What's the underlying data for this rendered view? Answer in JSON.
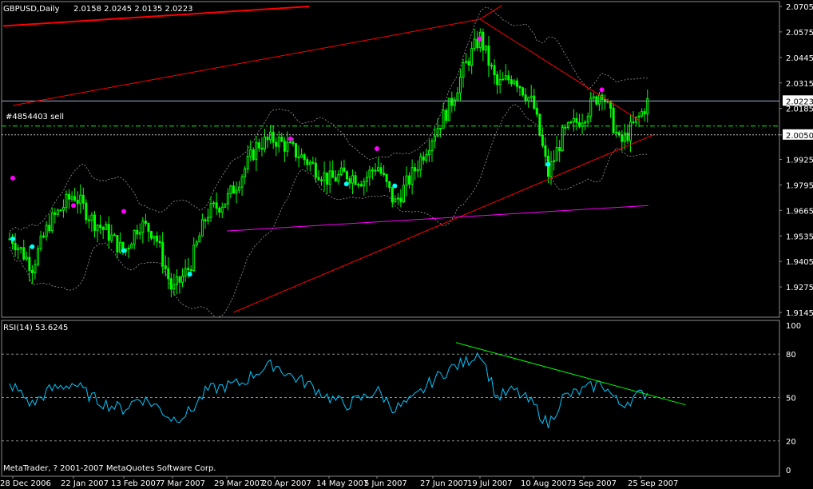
{
  "header": {
    "symbol": "GBPUSD,Daily",
    "ohlc": "2.0158 2.0245 2.0135 2.0223"
  },
  "order_label": "#4854403 sell",
  "rsi_title": "RSI(14) 53.6245",
  "copyright": "MetaTrader, ? 2001-2007 MetaQuotes Software Corp.",
  "colors": {
    "background": "#000000",
    "candle": "#00ff00",
    "channel": "#ff0000",
    "support": "#ff00ff",
    "rsi_line": "#00c8ff",
    "rsi_trend": "#00ff00",
    "bands": "#9a9a9a",
    "dot_magenta": "#ff00ff",
    "dot_cyan": "#00ffff",
    "price_marker": "#9fb2cf"
  },
  "chart_data": [
    {
      "type": "candlestick",
      "symbol": "GBPUSD",
      "timeframe": "Daily",
      "ylim": [
        1.9145,
        2.0705
      ],
      "y_ticks": [
        "2.0705",
        "2.0575",
        "2.0445",
        "2.0315",
        "2.0185",
        "2.0050",
        "1.9925",
        "1.9795",
        "1.9665",
        "1.9535",
        "1.9405",
        "1.9275",
        "1.9145"
      ],
      "x_ticks": [
        "28 Dec 2006",
        "22 Jan 2007",
        "13 Feb 2007",
        "7 Mar 2007",
        "29 Mar 2007",
        "20 Apr 2007",
        "14 May 2007",
        "5 Jun 2007",
        "27 Jun 2007",
        "19 Jul 2007",
        "10 Aug 2007",
        "3 Sep 2007",
        "25 Sep 2007"
      ],
      "current_price": "2.0223",
      "order_price": "2.0050",
      "close_path": [
        [
          "28 Dec 2006",
          1.952
        ],
        [
          "5 Jan 2007",
          1.938
        ],
        [
          "12 Jan 2007",
          1.96
        ],
        [
          "22 Jan 2007",
          1.975
        ],
        [
          "30 Jan 2007",
          1.962
        ],
        [
          "6 Feb 2007",
          1.955
        ],
        [
          "13 Feb 2007",
          1.945
        ],
        [
          "20 Feb 2007",
          1.96
        ],
        [
          "27 Feb 2007",
          1.955
        ],
        [
          "7 Mar 2007",
          1.925
        ],
        [
          "14 Mar 2007",
          1.938
        ],
        [
          "21 Mar 2007",
          1.965
        ],
        [
          "29 Mar 2007",
          1.972
        ],
        [
          "5 Apr 2007",
          1.985
        ],
        [
          "12 Apr 2007",
          2.0
        ],
        [
          "20 Apr 2007",
          2.003
        ],
        [
          "27 Apr 2007",
          1.998
        ],
        [
          "4 May 2007",
          1.992
        ],
        [
          "14 May 2007",
          1.982
        ],
        [
          "22 May 2007",
          1.985
        ],
        [
          "30 May 2007",
          1.982
        ],
        [
          "5 Jun 2007",
          1.99
        ],
        [
          "12 Jun 2007",
          1.97
        ],
        [
          "19 Jun 2007",
          1.985
        ],
        [
          "27 Jun 2007",
          2.005
        ],
        [
          "5 Jul 2007",
          2.02
        ],
        [
          "12 Jul 2007",
          2.04
        ],
        [
          "19 Jul 2007",
          2.055
        ],
        [
          "26 Jul 2007",
          2.03
        ],
        [
          "2 Aug 2007",
          2.035
        ],
        [
          "10 Aug 2007",
          2.02
        ],
        [
          "17 Aug 2007",
          1.985
        ],
        [
          "24 Aug 2007",
          2.005
        ],
        [
          "3 Sep 2007",
          2.015
        ],
        [
          "10 Sep 2007",
          2.028
        ],
        [
          "17 Sep 2007",
          2.0
        ],
        [
          "25 Sep 2007",
          2.015
        ],
        [
          "28 Sep 2007",
          2.0223
        ]
      ],
      "trendlines": [
        {
          "name": "channel-top",
          "color": "#ff0000",
          "from": [
            "28 Dec 2006",
            2.02
          ],
          "to": [
            "19 Jul 2007",
            2.064
          ]
        },
        {
          "name": "channel-top-upper",
          "color": "#ff0000",
          "from": [
            "19 Jul 2007",
            2.064
          ],
          "to": [
            "28 Jul 2007",
            2.071
          ]
        },
        {
          "name": "resistance-down",
          "color": "#ff0000",
          "from": [
            "19 Jul 2007",
            2.064
          ],
          "to": [
            "25 Sep 2007",
            2.012
          ]
        },
        {
          "name": "channel-bottom",
          "color": "#ff0000",
          "from": [
            "1 Apr 2007",
            1.9145
          ],
          "to": [
            "30 Sep 2007",
            2.005
          ]
        },
        {
          "name": "support",
          "color": "#ff00ff",
          "from": [
            "29 Mar 2007",
            1.956
          ],
          "to": [
            "28 Sep 2007",
            1.969
          ]
        }
      ],
      "fractal_up": [
        [
          "28 Dec 2006",
          1.983
        ],
        [
          "22 Jan 2007",
          1.969
        ],
        [
          "13 Feb 2007",
          1.966
        ],
        [
          "27 Apr 2007",
          2.003
        ],
        [
          "5 Jun 2007",
          1.998
        ],
        [
          "19 Jul 2007",
          2.054
        ],
        [
          "10 Sep 2007",
          2.028
        ]
      ],
      "fractal_down": [
        [
          "28 Dec 2006",
          1.952
        ],
        [
          "5 Jan 2007",
          1.948
        ],
        [
          "13 Feb 2007",
          1.946
        ],
        [
          "14 Mar 2007",
          1.934
        ],
        [
          "22 May 2007",
          1.98
        ],
        [
          "12 Jun 2007",
          1.979
        ],
        [
          "17 Aug 2007",
          1.99
        ]
      ]
    },
    {
      "type": "line",
      "name": "RSI(14)",
      "ylim": [
        0,
        100
      ],
      "y_ticks": [
        "100",
        "80",
        "50",
        "20",
        "0"
      ],
      "levels": [
        80,
        50,
        20
      ],
      "values": [
        [
          "28 Dec 2006",
          58
        ],
        [
          "5 Jan 2007",
          45
        ],
        [
          "12 Jan 2007",
          55
        ],
        [
          "22 Jan 2007",
          60
        ],
        [
          "30 Jan 2007",
          50
        ],
        [
          "6 Feb 2007",
          45
        ],
        [
          "13 Feb 2007",
          42
        ],
        [
          "20 Feb 2007",
          50
        ],
        [
          "27 Feb 2007",
          45
        ],
        [
          "7 Mar 2007",
          35
        ],
        [
          "14 Mar 2007",
          40
        ],
        [
          "21 Mar 2007",
          55
        ],
        [
          "29 Mar 2007",
          58
        ],
        [
          "5 Apr 2007",
          60
        ],
        [
          "12 Apr 2007",
          68
        ],
        [
          "20 Apr 2007",
          73
        ],
        [
          "27 Apr 2007",
          65
        ],
        [
          "4 May 2007",
          60
        ],
        [
          "14 May 2007",
          50
        ],
        [
          "22 May 2007",
          45
        ],
        [
          "30 May 2007",
          50
        ],
        [
          "5 Jun 2007",
          55
        ],
        [
          "12 Jun 2007",
          42
        ],
        [
          "19 Jun 2007",
          48
        ],
        [
          "27 Jun 2007",
          62
        ],
        [
          "5 Jul 2007",
          70
        ],
        [
          "12 Jul 2007",
          74
        ],
        [
          "19 Jul 2007",
          82
        ],
        [
          "26 Jul 2007",
          50
        ],
        [
          "2 Aug 2007",
          55
        ],
        [
          "10 Aug 2007",
          45
        ],
        [
          "17 Aug 2007",
          31
        ],
        [
          "24 Aug 2007",
          50
        ],
        [
          "3 Sep 2007",
          55
        ],
        [
          "10 Sep 2007",
          60
        ],
        [
          "17 Sep 2007",
          45
        ],
        [
          "25 Sep 2007",
          52
        ],
        [
          "28 Sep 2007",
          53.6
        ]
      ],
      "trendline": {
        "color": "#00ff00",
        "from": [
          "19 Jul 2007",
          85
        ],
        "to": [
          "30 Sep 2007",
          45
        ]
      }
    }
  ]
}
